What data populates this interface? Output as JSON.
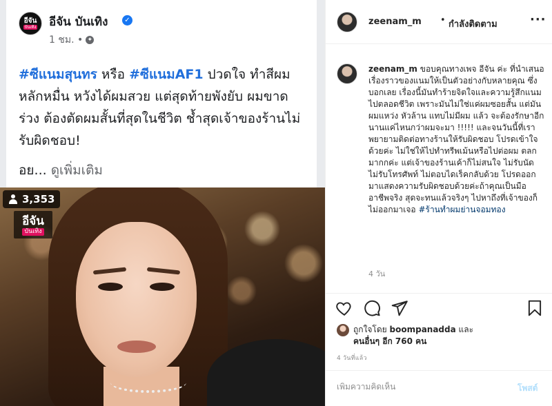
{
  "facebook": {
    "page_name": "อีจัน บันเทิง",
    "avatar_text": "อีจัน",
    "avatar_subtext": "บันเทิง",
    "time": "1 ชม. •",
    "post_lines": [
      {
        "parts": [
          {
            "text": "#ซีแนมสุนทร",
            "tag": true
          },
          {
            "text": " หรือ ",
            "tag": false
          },
          {
            "text": "#ซีแนมAF1",
            "tag": true
          },
          {
            "text": " ปวดใจ ทำสีผม",
            "tag": false
          }
        ]
      },
      {
        "parts": [
          {
            "text": "หลักหมื่น หวังได้ผมสวย แต่สุดท้ายพังยับ ผมขาด",
            "tag": false
          }
        ]
      },
      {
        "parts": [
          {
            "text": "ร่วง ต้องตัดผมสั้นที่สุดในชีวิต ช้ำสุดเจ้าของร้านไม่",
            "tag": false
          }
        ]
      },
      {
        "parts": [
          {
            "text": "รับผิดชอบ!",
            "tag": false
          }
        ]
      }
    ],
    "post_truncated": "อย...",
    "see_more": "ดูเพิ่มเติม",
    "viewer_count": "3,353",
    "logo_line1": "อีจัน",
    "logo_line2": "บันเทิง",
    "colors": {
      "tag": "#216fdb",
      "brand_pink": "#e0115f",
      "verified": "#1877f2"
    }
  },
  "instagram": {
    "username": "zeenam_m",
    "header_separator": "•",
    "following_label": "กำลังติดตาม",
    "more_icon": "more-dots-icon",
    "caption_user": "zeenam_m",
    "caption_text": " ขอบคุณทางเพจ อีจัน ค่ะ ที่นำเสนอเรื่องราวของแนมให้เป็นตัวอย่างกับหลายคุณ ซึ่งบอกเลย เรื่องนี้มันทำร้ายจิตใจและความรู้สึกแนมไปตลอดชีวิต เพราะมันไม่ใช่แค่ผมซอยสั้น แต่มันผมแหว่ง หัวล้าน แทบไม่มีผม แล้ว จะต้องรักษาอีกนานแค่ไหนกว่าผมจะมา !!!!! และจนวันนี้ที่เราพยายามติดต่อทางร้านให้รับผิดชอบ โปรดเข้าใจด้วยค่ะ ไม่ใช่ให้ไปทำทรีพเม้นหรือไปต่อผม ตลกมากกค่ะ แต่เจ้าของร้านเค้าก็ไม่สนใจ ไม่รับนัด ไม่รับโทรศัพท์ ไม่ตอบไดเร็คกลับด้วย โปรดออกมาแสดงความรับผิดชอบด้วยค่ะถ้าคุณเป็นมืออาชีพจริง สุดจะทนแล้วจริงๆ ไปหาถึงที่เจ้าของก็ไม่ออกมาเจอ ",
    "caption_hashtag": "#ร้านทำผมย่านจอมทอง",
    "caption_age": "4 วัน",
    "liked_by_prefix": "ถูกใจโดย ",
    "liked_by_user": "boompanadda",
    "liked_by_mid": " และ",
    "liked_by_others": "คนอื่นๆ อีก 760 คน",
    "post_date": "4 วันที่แล้ว",
    "comment_placeholder": "เพิ่มความคิดเห็น",
    "post_button": "โพสต์",
    "icons": [
      "heart-icon",
      "comment-icon",
      "share-icon",
      "bookmark-icon"
    ],
    "colors": {
      "link": "#00376b",
      "post_disabled": "#b2dffc",
      "muted": "#8e8e8e"
    }
  }
}
